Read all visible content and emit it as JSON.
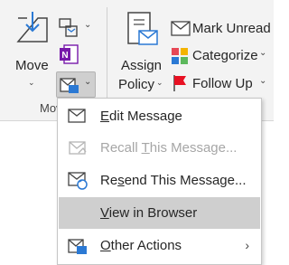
{
  "ribbon": {
    "move": {
      "label": "Move"
    },
    "group_label": "Move",
    "assign_policy": {
      "line1": "Assign",
      "line2": "Policy"
    },
    "mark_unread": {
      "label": "Mark Unread"
    },
    "categorize": {
      "label": "Categorize"
    },
    "follow_up": {
      "label": "Follow Up"
    }
  },
  "actions_menu": {
    "items": [
      {
        "prefix": "",
        "accel": "E",
        "suffix": "dit Message",
        "enabled": true,
        "highlighted": false,
        "icon": "edit-message-icon"
      },
      {
        "prefix": "Recall ",
        "accel": "T",
        "suffix": "his Message...",
        "enabled": false,
        "highlighted": false,
        "icon": "recall-message-icon"
      },
      {
        "prefix": "Re",
        "accel": "s",
        "suffix": "end This Message...",
        "enabled": true,
        "highlighted": false,
        "icon": "resend-message-icon"
      },
      {
        "prefix": "",
        "accel": "V",
        "suffix": "iew in Browser",
        "enabled": true,
        "highlighted": true,
        "icon": ""
      },
      {
        "prefix": "",
        "accel": "O",
        "suffix": "ther Actions",
        "enabled": true,
        "highlighted": false,
        "icon": "other-actions-icon",
        "submenu": true
      }
    ]
  },
  "colors": {
    "accent_blue": "#2b79d4",
    "onenote_purple": "#7719aa",
    "categorize_red": "#e74856",
    "categorize_yellow": "#f4b400",
    "categorize_blue": "#2b79d4",
    "categorize_green": "#5cb85c",
    "follow_up_red": "#e81123"
  }
}
